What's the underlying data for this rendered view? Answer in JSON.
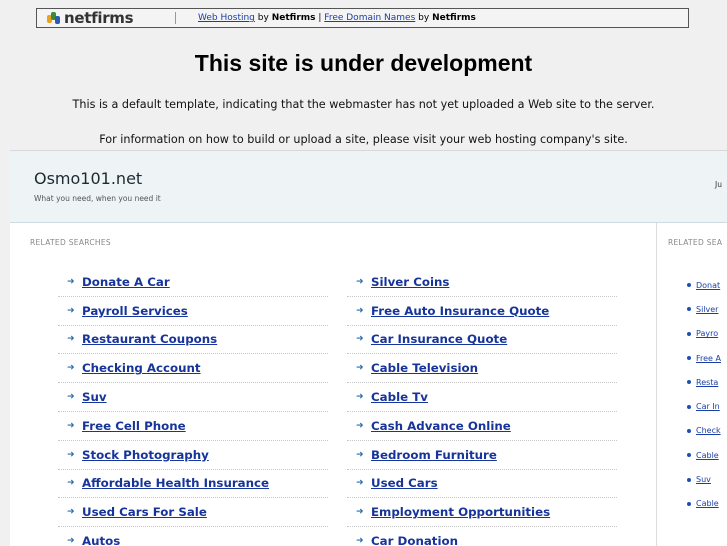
{
  "netfirms_bar": {
    "logo_text": "netfirms",
    "link1": "Web Hosting",
    "by1": "by",
    "brand1": "Netfirms",
    "sep": "|",
    "link2": "Free Domain Names",
    "by2": "by",
    "brand2": "Netfirms"
  },
  "heading": "This site is under development",
  "message1": "This is a default template, indicating that the webmaster has not yet uploaded a Web site to the server.",
  "message2": "For information on how to build or upload a site, please visit your web hosting company's site.",
  "site": {
    "title": "Osmo101.net",
    "tagline": "What you need, when you need it",
    "header_right": "Ju"
  },
  "related_label": "RELATED SEARCHES",
  "side_label": "RELATED SEA",
  "left_links": [
    "Donate A Car",
    "Payroll Services",
    "Restaurant Coupons",
    "Checking Account",
    "Suv",
    "Free Cell Phone",
    "Stock Photography",
    "Affordable Health Insurance",
    "Used Cars For Sale",
    "Autos"
  ],
  "right_links": [
    "Silver Coins",
    "Free Auto Insurance Quote",
    "Car Insurance Quote",
    "Cable Television",
    "Cable Tv",
    "Cash Advance Online",
    "Bedroom Furniture",
    "Used Cars",
    "Employment Opportunities",
    "Car Donation"
  ],
  "side_links": [
    "Donat",
    "Silver",
    "Payro",
    "Free A",
    "Resta",
    "Car In",
    "Check",
    "Cable",
    "Suv",
    "Cable"
  ],
  "colors": {
    "link": "#16349a",
    "header_bg": "#eef3f6",
    "page_bg": "#f0f0f0"
  }
}
